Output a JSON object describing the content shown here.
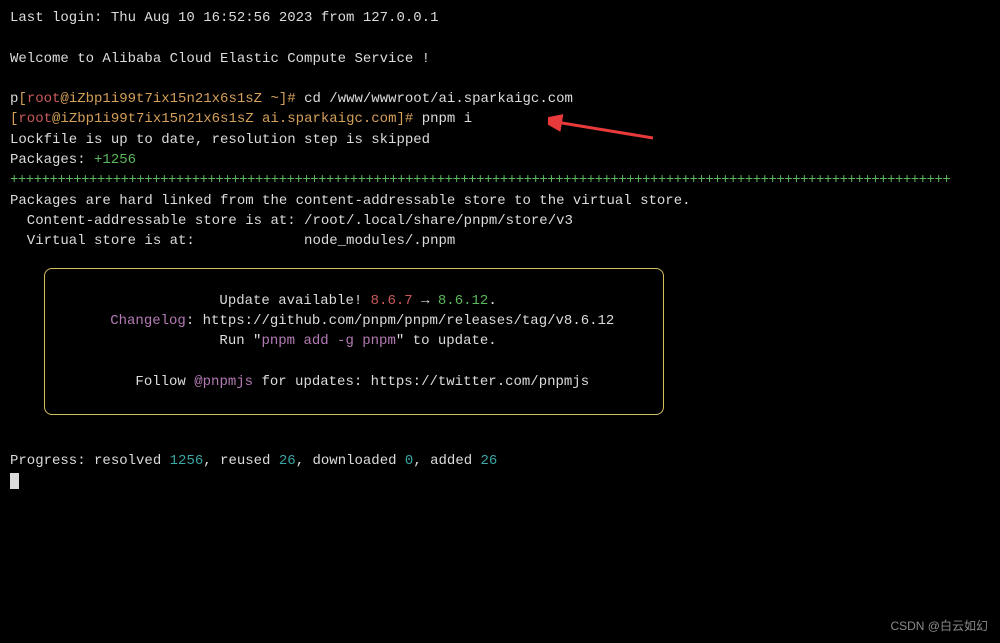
{
  "login_line": "Last login: Thu Aug 10 16:52:56 2023 from 127.0.0.1",
  "welcome_line": "Welcome to Alibaba Cloud Elastic Compute Service !",
  "prompt1": {
    "prefix": "p",
    "open": "[",
    "user": "root",
    "at": "@",
    "host": "iZbp1i99t7ix15n21x6s1sZ",
    "path": " ~",
    "close": "]#",
    "cmd": " cd /www/wwwroot/ai.sparkaigc.com"
  },
  "prompt2": {
    "open": "[",
    "user": "root",
    "at": "@",
    "host": "iZbp1i99t7ix15n21x6s1sZ",
    "path": " ai.sparkaigc.com",
    "close": "]#",
    "cmd": " pnpm i"
  },
  "lockfile_line": "Lockfile is up to date, resolution step is skipped",
  "packages_label": "Packages:",
  "packages_count": " +1256",
  "plus_bar": "+++++++++++++++++++++++++++++++++++++++++++++++++++++++++++++++++++++++++++++++++++++++++++++++++++++++++++++++++++++++",
  "hardlink_line": "Packages are hard linked from the content-addressable store to the virtual store.",
  "cas_line": "  Content-addressable store is at: /root/.local/share/pnpm/store/v3",
  "vs_line": "  Virtual store is at:             node_modules/.pnpm",
  "update": {
    "avail_label": "Update available! ",
    "old_ver": "8.6.7",
    "arrow": " → ",
    "new_ver": "8.6.12",
    "dot": ".",
    "changelog_label": "Changelog",
    "changelog_sep": ": ",
    "changelog_url": "https://github.com/pnpm/pnpm/releases/tag/v8.6.12",
    "run_prefix": "Run \"",
    "run_cmd": "pnpm add -g pnpm",
    "run_suffix": "\" to update.",
    "follow_prefix": "Follow ",
    "follow_handle": "@pnpmjs",
    "follow_mid": " for updates: ",
    "follow_url": "https://twitter.com/pnpmjs"
  },
  "progress": {
    "label": "Progress: resolved ",
    "resolved": "1256",
    "reused_label": ", reused ",
    "reused": "26",
    "downloaded_label": ", downloaded ",
    "downloaded": "0",
    "added_label": ", added ",
    "added": "26"
  },
  "watermark": "CSDN @白云如幻"
}
